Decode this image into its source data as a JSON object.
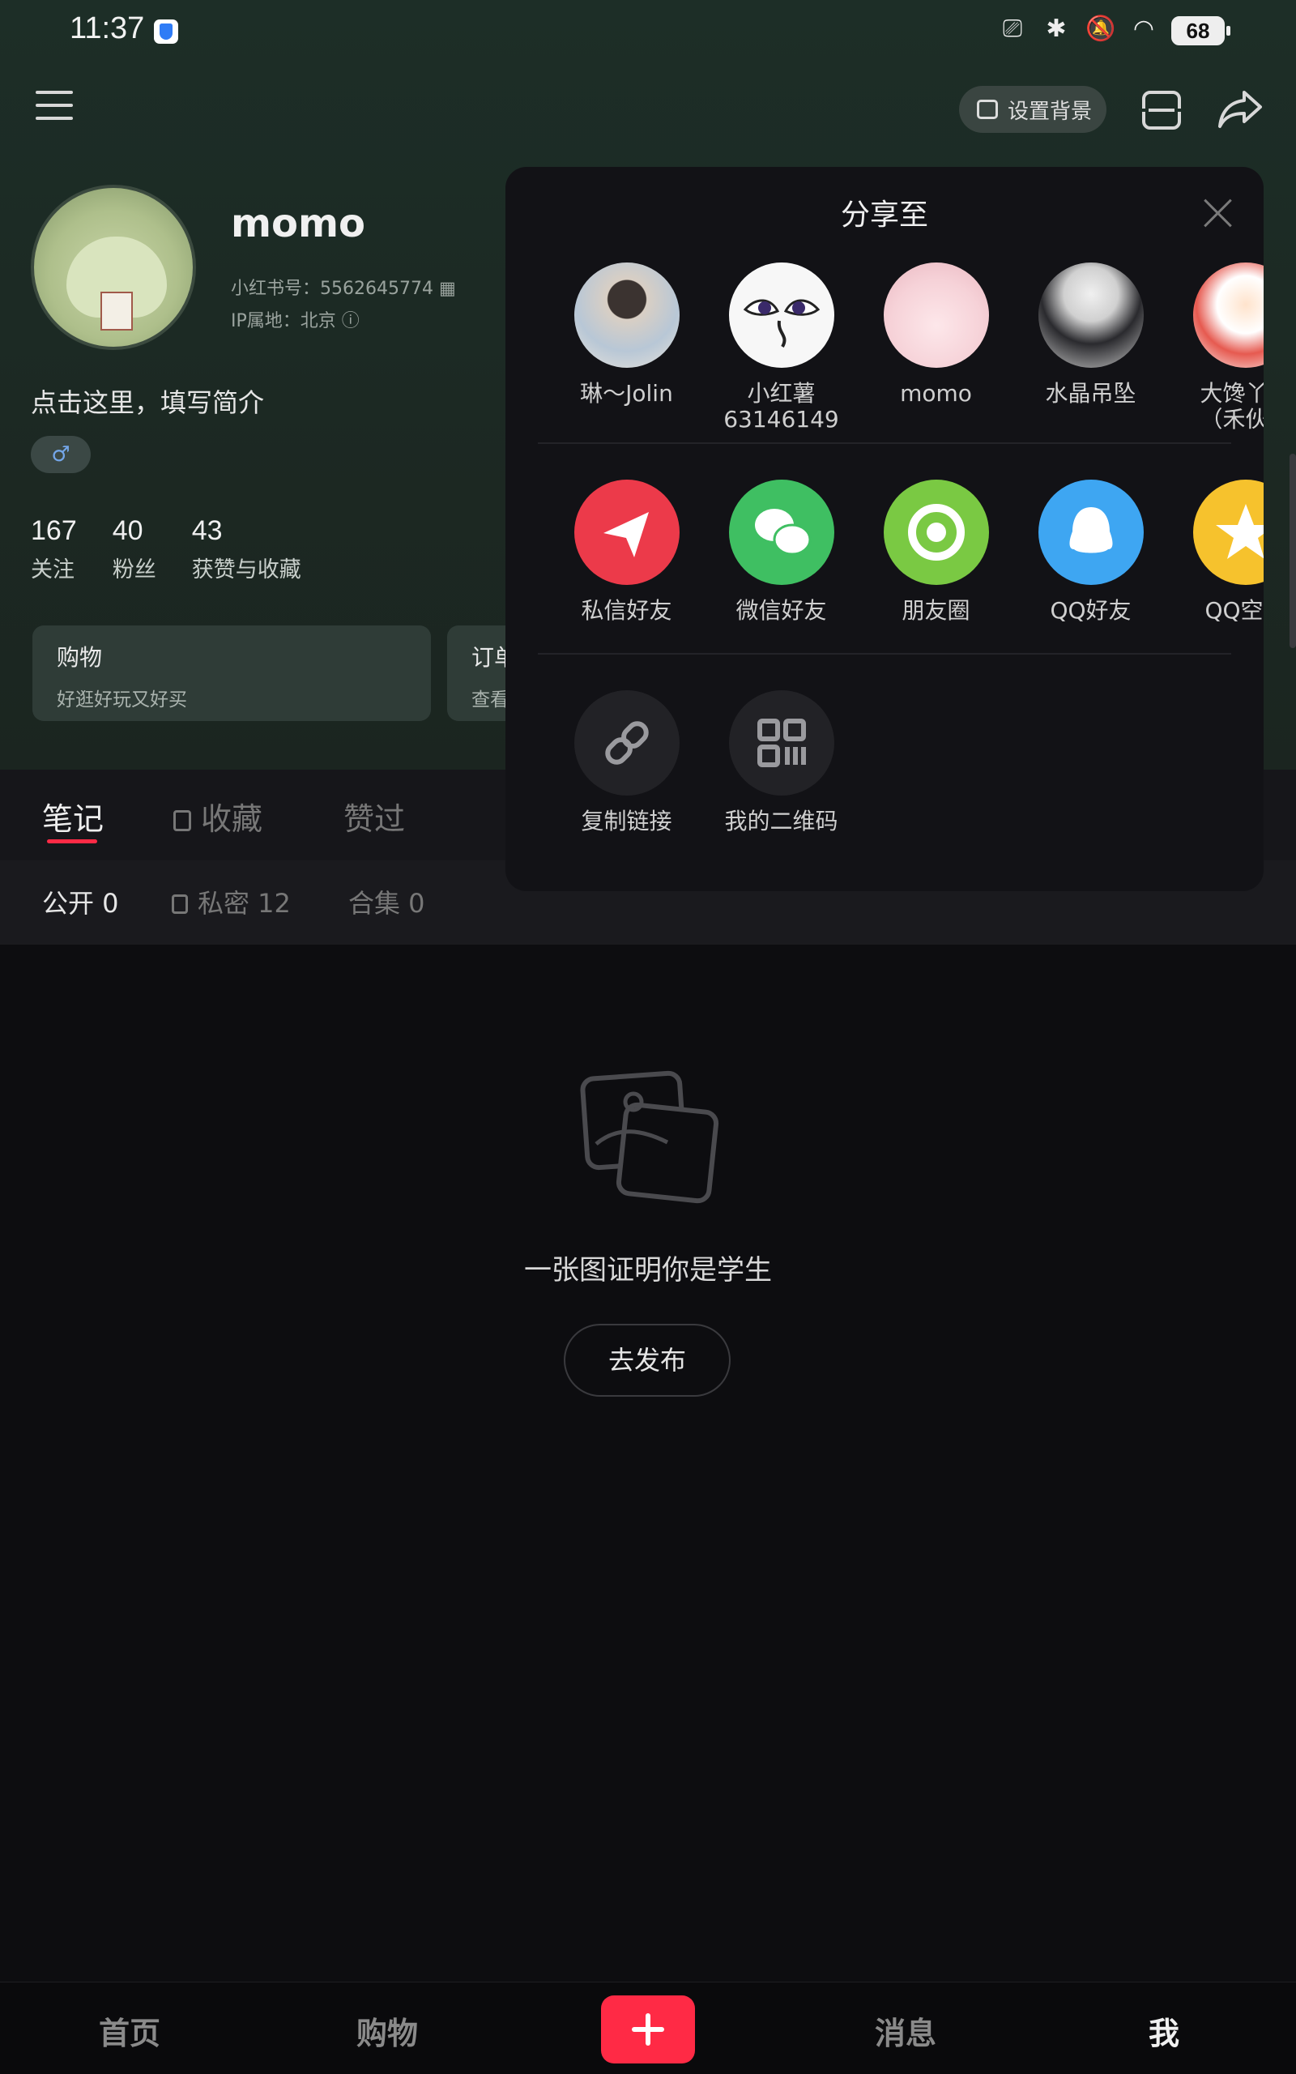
{
  "status": {
    "time": "11:37",
    "battery": "68"
  },
  "topbar": {
    "set_background": "设置背景"
  },
  "profile": {
    "name": "momo",
    "id_line": "小红书号：5562645774",
    "ip_line": "IP属地：北京",
    "bio": "点击这里，填写简介",
    "gender_symbol": "♂",
    "stats": [
      {
        "num": "167",
        "label": "关注"
      },
      {
        "num": "40",
        "label": "粉丝"
      },
      {
        "num": "43",
        "label": "获赞与收藏"
      }
    ],
    "cards": [
      {
        "title": "购物",
        "subtitle": "好逛好玩又好买"
      },
      {
        "title": "订单",
        "subtitle": "查看"
      }
    ]
  },
  "tabs": [
    "笔记",
    "收藏",
    "赞过"
  ],
  "subtabs": [
    "公开 0",
    "私密 12",
    "合集 0"
  ],
  "empty": {
    "text": "一张图证明你是学生",
    "button": "去发布"
  },
  "bottom_nav": [
    "首页",
    "购物",
    "消息",
    "我"
  ],
  "share": {
    "title": "分享至",
    "contacts": [
      {
        "name": "琳～Jolin",
        "avatar": "person-photo"
      },
      {
        "name": "小红薯\n63146149",
        "avatar": "buddha-eyes"
      },
      {
        "name": "momo",
        "avatar": "pink-monster"
      },
      {
        "name": "水晶吊坠",
        "avatar": "panda-hat-person"
      },
      {
        "name": "大馋丫头\n（禾伙人",
        "avatar": "cartoon-girl"
      }
    ],
    "apps": [
      {
        "name": "私信好友",
        "color": "#ec3a4a",
        "icon": "paper-plane-icon",
        "glyph": "➤"
      },
      {
        "name": "微信好友",
        "color": "#3fbf62",
        "icon": "wechat-icon",
        "glyph": "💬"
      },
      {
        "name": "朋友圈",
        "color": "#7ac943",
        "icon": "moments-icon",
        "glyph": "◎"
      },
      {
        "name": "QQ好友",
        "color": "#3ea6f2",
        "icon": "qq-icon",
        "glyph": "🐧"
      },
      {
        "name": "QQ空间",
        "color": "#f6c22d",
        "icon": "qzone-icon",
        "glyph": "★"
      }
    ],
    "actions": [
      {
        "name": "复制链接",
        "icon": "link-icon",
        "glyph": "🔗"
      },
      {
        "name": "我的二维码",
        "icon": "qr-code-icon",
        "glyph": "▦"
      }
    ]
  }
}
